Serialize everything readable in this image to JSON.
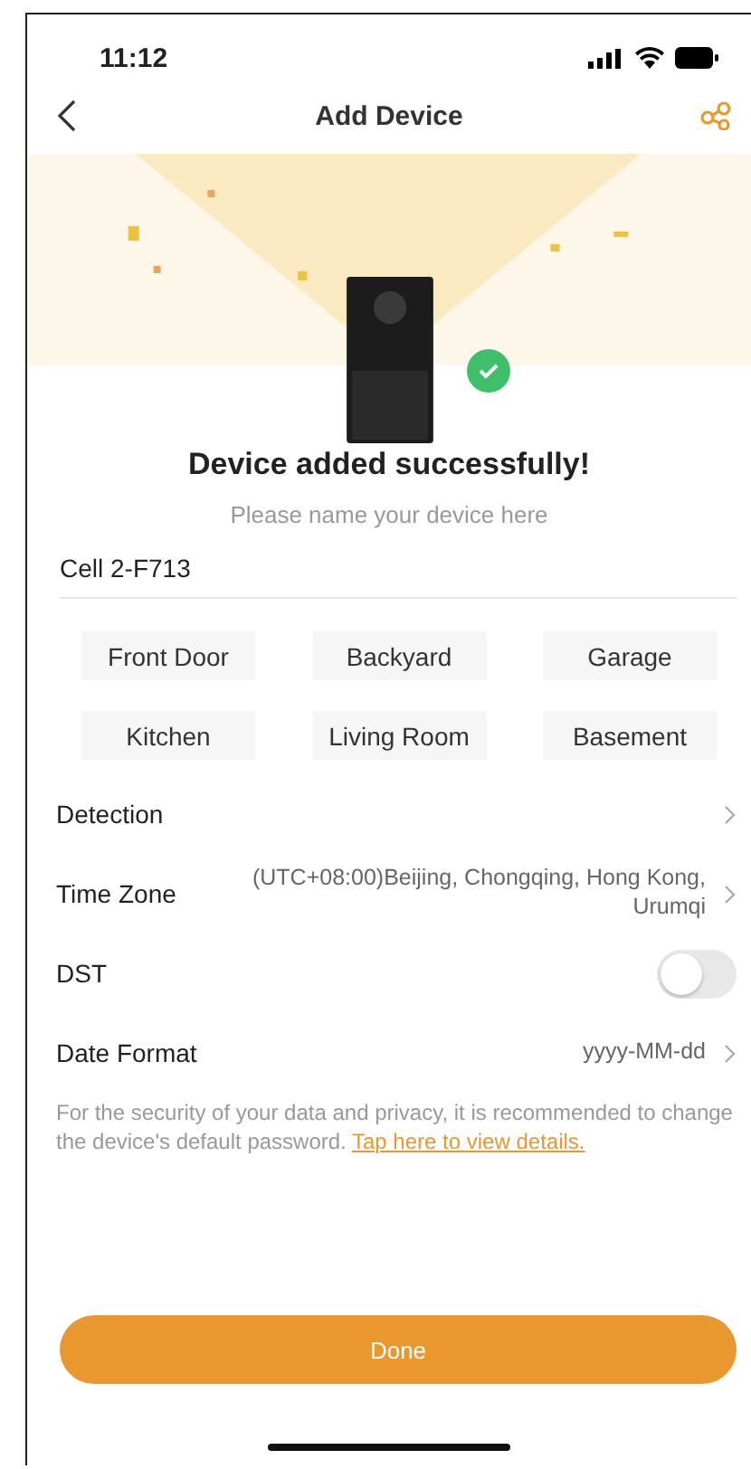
{
  "status_bar": {
    "time": "11:12"
  },
  "nav": {
    "title": "Add Device"
  },
  "success": {
    "title": "Device added successfully!",
    "prompt": "Please name your device here"
  },
  "name_field": {
    "value": "Cell 2-F713"
  },
  "suggestions": [
    {
      "label": "Front Door"
    },
    {
      "label": "Backyard"
    },
    {
      "label": "Garage"
    },
    {
      "label": "Kitchen"
    },
    {
      "label": "Living Room"
    },
    {
      "label": "Basement"
    }
  ],
  "settings": [
    {
      "kind": "link",
      "label": "Detection"
    },
    {
      "kind": "link",
      "label": "Time Zone",
      "value": "(UTC+08:00)Beijing, Chongqing, Hong Kong, Urumqi"
    },
    {
      "kind": "toggle",
      "label": "DST",
      "on": false
    },
    {
      "kind": "link",
      "label": "Date Format",
      "value": "yyyy-MM-dd"
    }
  ],
  "notice": {
    "text": "For the security of your data and privacy, it is recommended to change the device's default password.",
    "link": "Tap here to view details."
  },
  "buttons": [
    {
      "label": "Done"
    }
  ]
}
